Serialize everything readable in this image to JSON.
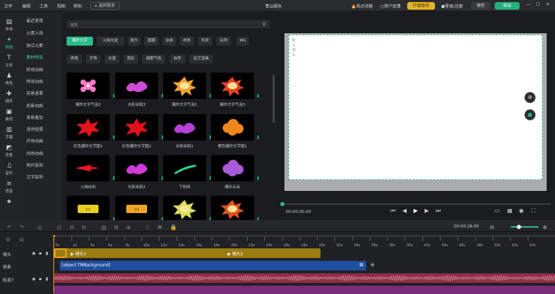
{
  "menu": [
    "文件",
    "编辑",
    "工具",
    "视图",
    "帮助"
  ],
  "home_button": "返回首页",
  "project_title": "青山绿水",
  "top_right": {
    "hot": "热点功能",
    "feedback": "用户反馈",
    "upgrade": "升级账号",
    "login": "登录/注册",
    "save": "保存",
    "export": "导出"
  },
  "rail": [
    {
      "label": "本地",
      "icon": "folder-icon"
    },
    {
      "label": "特效",
      "icon": "magic-icon"
    },
    {
      "label": "文本",
      "icon": "text-icon"
    },
    {
      "label": "角色",
      "icon": "person-icon"
    },
    {
      "label": "插件",
      "icon": "plugin-icon"
    },
    {
      "label": "素材",
      "icon": "material-icon"
    },
    {
      "label": "字幕",
      "icon": "subtitle-icon"
    },
    {
      "label": "背景",
      "icon": "background-icon"
    },
    {
      "label": "音乐",
      "icon": "music-icon"
    },
    {
      "label": "语音",
      "icon": "voice-icon"
    },
    {
      "label": "",
      "icon": "star-icon"
    }
  ],
  "categories": [
    "最近使用",
    "元素入场",
    "独立元素",
    "素材特效",
    "转场动画",
    "特效动画",
    "前景遮罩",
    "前景动画",
    "背景叠加",
    "进场扭摆",
    "开场动画",
    "闭场动画",
    "图片装饰",
    "文字装饰"
  ],
  "search_placeholder": "搜索",
  "tags_row1": [
    "爆炸文字",
    "火焰光波",
    "箭头",
    "圆圈",
    "涂抹",
    "线条",
    "形状",
    "杂项",
    "MG"
  ],
  "tags_row2": [
    "表情",
    "手势",
    "水墨",
    "霓虹",
    "烟雾气氛",
    "自然",
    "综艺道具"
  ],
  "thumbs": [
    {
      "label": "爆炸文字气泡2",
      "color": "#ff7ac8",
      "shape": "flower"
    },
    {
      "label": "水彩涂鸦3",
      "color": "#d24bd8",
      "shape": "splash"
    },
    {
      "label": "爆炸文字气泡1",
      "color": "#f5a033",
      "shape": "burst"
    },
    {
      "label": "爆炸文字气泡3",
      "color": "#e8421c",
      "shape": "burst2"
    },
    {
      "label": "红色爆炸文字圆1",
      "color": "#e0141c",
      "shape": "star"
    },
    {
      "label": "红色爆炸文字圆2",
      "color": "#e3101c",
      "shape": "star2"
    },
    {
      "label": "水彩涂鸦1",
      "color": "#b63fd6",
      "shape": "splash"
    },
    {
      "label": "橙色爆炸文字圆1",
      "color": "#f0871e",
      "shape": "cloud"
    },
    {
      "label": "火焰向右",
      "color": "#e81632",
      "shape": "arrow"
    },
    {
      "label": "水彩涂鸦2",
      "color": "#cf3bd8",
      "shape": "splash2"
    },
    {
      "label": "下划线",
      "color": "#2ad48e",
      "shape": "line"
    },
    {
      "label": "爆炸云朵",
      "color": "#a85ad8",
      "shape": "cloud2"
    },
    {
      "label": "",
      "color": "#e8d21c",
      "shape": "comic"
    },
    {
      "label": "",
      "color": "#f0a622",
      "shape": "comic2"
    },
    {
      "label": "",
      "color": "#d5e05a",
      "shape": "burst3"
    },
    {
      "label": "",
      "color": "#e0541c",
      "shape": "burst4"
    }
  ],
  "canvas_label": "默认镜头",
  "time_display": "00:00:00.00",
  "zoom_time": "00:00:28.00",
  "tracks": [
    {
      "label": "镜头"
    },
    {
      "label": "背景"
    },
    {
      "label": "轨道7"
    },
    {
      "label": ""
    }
  ],
  "clips": {
    "shot1": "镜头1",
    "shot2": "镜头2",
    "background": "[object TMBackground]"
  },
  "ruler_ticks": [
    "0s",
    "2s",
    "4s",
    "6s",
    "8s",
    "10s",
    "12s",
    "14s",
    "16s",
    "18s",
    "20s",
    "22s",
    "24s",
    "26s",
    "28s",
    "30s",
    "32s",
    "34s",
    "36s",
    "38s",
    "40s",
    "42s",
    "44s",
    "46s",
    "48s",
    "50s",
    "52s",
    "54s"
  ]
}
